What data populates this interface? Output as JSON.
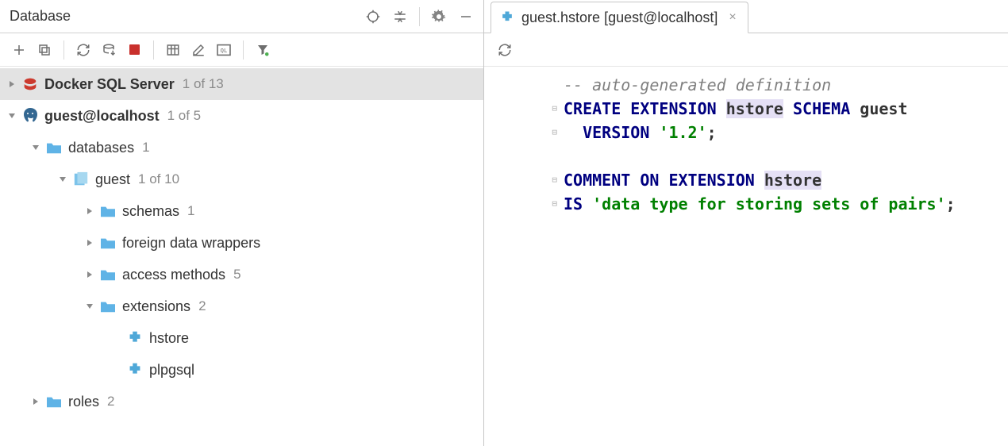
{
  "panel": {
    "title": "Database"
  },
  "tree": {
    "datasources": [
      {
        "name": "Docker SQL Server",
        "count": "1 of 13",
        "icon": "sqlserver",
        "expanded": false
      },
      {
        "name": "guest@localhost",
        "count": "1 of 5",
        "icon": "postgres",
        "expanded": true
      }
    ],
    "databases_label": "databases",
    "databases_count": "1",
    "db_guest_label": "guest",
    "db_guest_count": "1 of 10",
    "schemas_label": "schemas",
    "schemas_count": "1",
    "fdw_label": "foreign data wrappers",
    "access_label": "access methods",
    "access_count": "5",
    "extensions_label": "extensions",
    "extensions_count": "2",
    "ext_hstore": "hstore",
    "ext_plpgsql": "plpgsql",
    "roles_label": "roles",
    "roles_count": "2"
  },
  "tab": {
    "label": "guest.hstore [guest@localhost]"
  },
  "code": {
    "l1_comment": "-- auto-generated definition",
    "l2_kw1": "CREATE EXTENSION ",
    "l2_id": "hstore",
    "l2_kw2": " SCHEMA ",
    "l2_id2": "guest",
    "l3_indent": "  ",
    "l3_kw": "VERSION ",
    "l3_str": "'1.2'",
    "l3_semi": ";",
    "l5_kw": "COMMENT ON EXTENSION ",
    "l5_id": "hstore",
    "l6_kw": "IS ",
    "l6_str": "'data type for storing sets of pairs'",
    "l6_semi": ";"
  }
}
